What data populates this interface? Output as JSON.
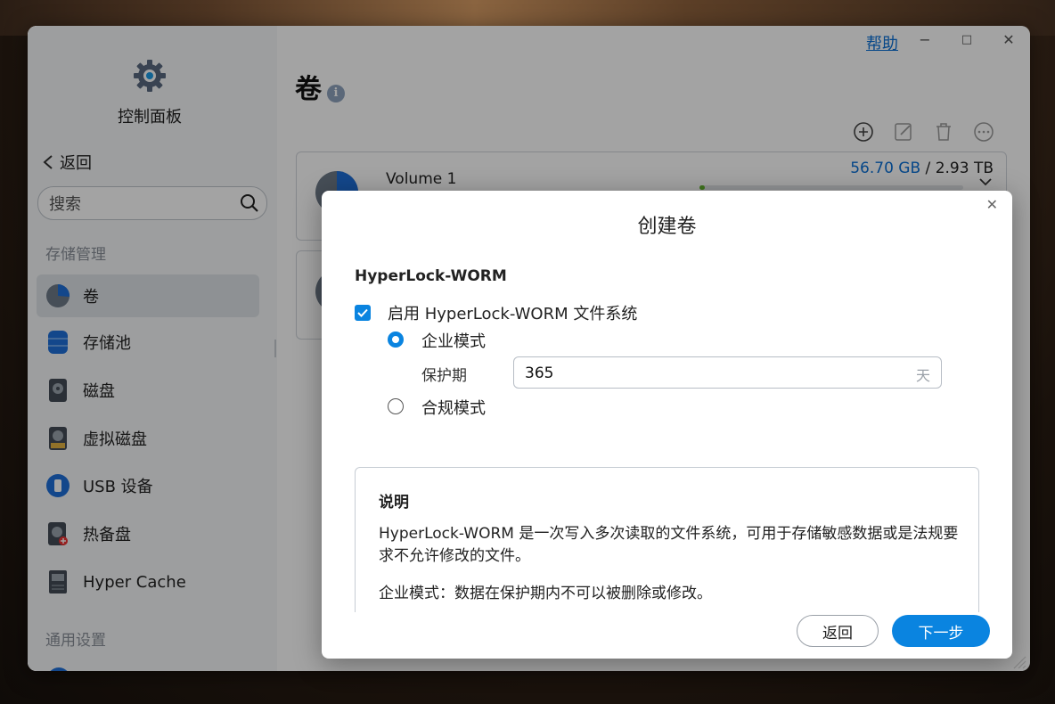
{
  "window": {
    "help_link": "帮助",
    "controls": {
      "minimize": "−",
      "maximize": "□",
      "close": "✕"
    }
  },
  "sidebar": {
    "control_panel_title": "控制面板",
    "back_label": "返回",
    "search_placeholder": "搜索",
    "section_storage": "存储管理",
    "items": [
      {
        "label": "卷",
        "icon": "volume-pie-icon",
        "active": true
      },
      {
        "label": "存储池",
        "icon": "storage-pool-icon"
      },
      {
        "label": "磁盘",
        "icon": "disk-icon"
      },
      {
        "label": "虚拟磁盘",
        "icon": "virtual-disk-icon"
      },
      {
        "label": "USB 设备",
        "icon": "usb-icon"
      },
      {
        "label": "热备盘",
        "icon": "hot-spare-icon"
      },
      {
        "label": "Hyper Cache",
        "icon": "hyper-cache-icon"
      }
    ],
    "section_general": "通用设置"
  },
  "main": {
    "title": "卷",
    "toolbar": [
      "add-icon",
      "edit-icon",
      "delete-icon",
      "more-icon"
    ],
    "volumes": [
      {
        "name": "Volume 1",
        "used": "56.70 GB",
        "separator": " / ",
        "total": "2.93 TB",
        "usage_fraction": 0.02
      }
    ]
  },
  "dialog": {
    "title": "创建卷",
    "section_title": "HyperLock-WORM",
    "enable_label": "启用 HyperLock-WORM 文件系统",
    "enable_checked": true,
    "enterprise_mode": "企业模式",
    "enterprise_selected": true,
    "protection_period_label": "保护期",
    "protection_period_value": "365",
    "protection_period_unit": "天",
    "compliance_mode": "合规模式",
    "description_title": "说明",
    "description_p1": "HyperLock-WORM 是一次写入多次读取的文件系统，可用于存储敏感数据或是法规要求不允许修改的文件。",
    "description_p2": "企业模式：数据在保护期内不可以被删除或修改。",
    "back_button": "返回",
    "next_button": "下一步"
  },
  "colors": {
    "accent": "#0a84e0",
    "link": "#0a6fd6",
    "usage_green": "#63b62f"
  }
}
